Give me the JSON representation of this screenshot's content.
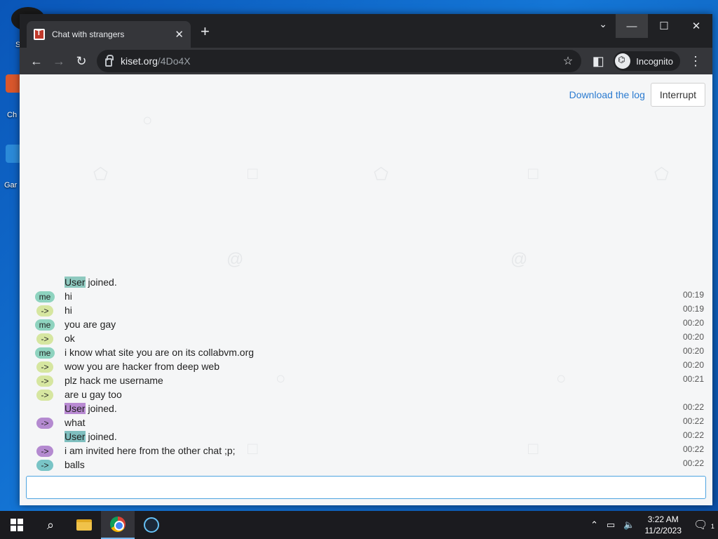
{
  "browser": {
    "tab_title": "Chat with strangers",
    "url_host": "kiset.org",
    "url_path": "/4Do4X",
    "incognito_label": "Incognito"
  },
  "page": {
    "download_log": "Download the log",
    "interrupt": "Interrupt",
    "input_value": ""
  },
  "log": [
    {
      "badge": "",
      "badge_type": "",
      "pre": "",
      "hl": "User",
      "hl_type": "hl-teal",
      "text": " joined.",
      "time": ""
    },
    {
      "badge": "me",
      "badge_type": "me",
      "pre": "",
      "hl": "",
      "hl_type": "",
      "text": "hi",
      "time": "00:19"
    },
    {
      "badge": "->",
      "badge_type": "g",
      "pre": "",
      "hl": "",
      "hl_type": "",
      "text": "hi",
      "time": "00:19"
    },
    {
      "badge": "me",
      "badge_type": "me",
      "pre": "",
      "hl": "",
      "hl_type": "",
      "text": "you are gay",
      "time": "00:20"
    },
    {
      "badge": "->",
      "badge_type": "g",
      "pre": "",
      "hl": "",
      "hl_type": "",
      "text": "ok",
      "time": "00:20"
    },
    {
      "badge": "me",
      "badge_type": "me",
      "pre": "",
      "hl": "",
      "hl_type": "",
      "text": "i know what site you are on its collabvm.org",
      "time": "00:20"
    },
    {
      "badge": "->",
      "badge_type": "g",
      "pre": "",
      "hl": "",
      "hl_type": "",
      "text": "wow you are hacker from deep web",
      "time": "00:20"
    },
    {
      "badge": "->",
      "badge_type": "g",
      "pre": "",
      "hl": "",
      "hl_type": "",
      "text": "plz hack me username",
      "time": "00:21"
    },
    {
      "badge": "->",
      "badge_type": "g",
      "pre": "",
      "hl": "",
      "hl_type": "",
      "text": "are u gay too",
      "time": ""
    },
    {
      "badge": "",
      "badge_type": "",
      "pre": "",
      "hl": "User",
      "hl_type": "hl-purple",
      "text": " joined.",
      "time": "00:22"
    },
    {
      "badge": "->",
      "badge_type": "p",
      "pre": "",
      "hl": "",
      "hl_type": "",
      "text": "what",
      "time": "00:22"
    },
    {
      "badge": "",
      "badge_type": "",
      "pre": "",
      "hl": "User",
      "hl_type": "hl-teal2",
      "text": " joined.",
      "time": "00:22"
    },
    {
      "badge": "->",
      "badge_type": "p",
      "pre": "",
      "hl": "",
      "hl_type": "",
      "text": "i am invited here from the other chat ;p;",
      "time": "00:22"
    },
    {
      "badge": "->",
      "badge_type": "t",
      "pre": "",
      "hl": "",
      "hl_type": "",
      "text": "balls",
      "time": "00:22"
    }
  ],
  "taskbar": {
    "time": "3:22 AM",
    "date": "11/2/2023",
    "notifications": "1"
  },
  "desktop": {
    "icon_labels": [
      "S",
      "Ch",
      "Gar"
    ]
  },
  "icons": {
    "back": "arrow-left-icon",
    "forward": "arrow-right-icon",
    "reload": "reload-icon",
    "star": "star-icon",
    "sidepanel": "side-panel-icon",
    "menu": "kebab-menu-icon"
  }
}
